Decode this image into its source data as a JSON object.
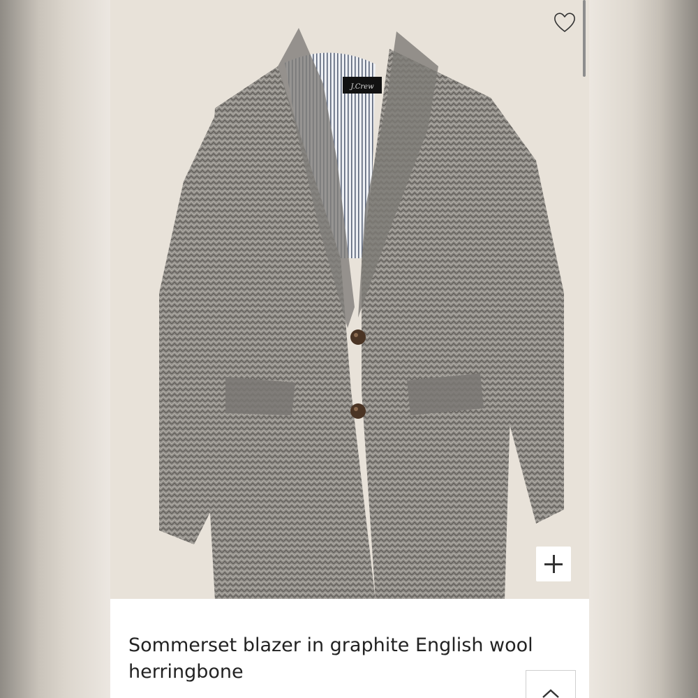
{
  "product": {
    "title": "Sommerset blazer in graphite English wool herringbone",
    "brand_label": "J.Crew",
    "image_subject": "grey herringbone wool blazer"
  },
  "icons": {
    "favorite": "heart-icon",
    "zoom": "plus-icon",
    "back_to_top": "chevron-up-icon"
  },
  "colors": {
    "image_background": "#e8e2d9",
    "blazer_fabric": "#8a8782",
    "text": "#222222"
  }
}
